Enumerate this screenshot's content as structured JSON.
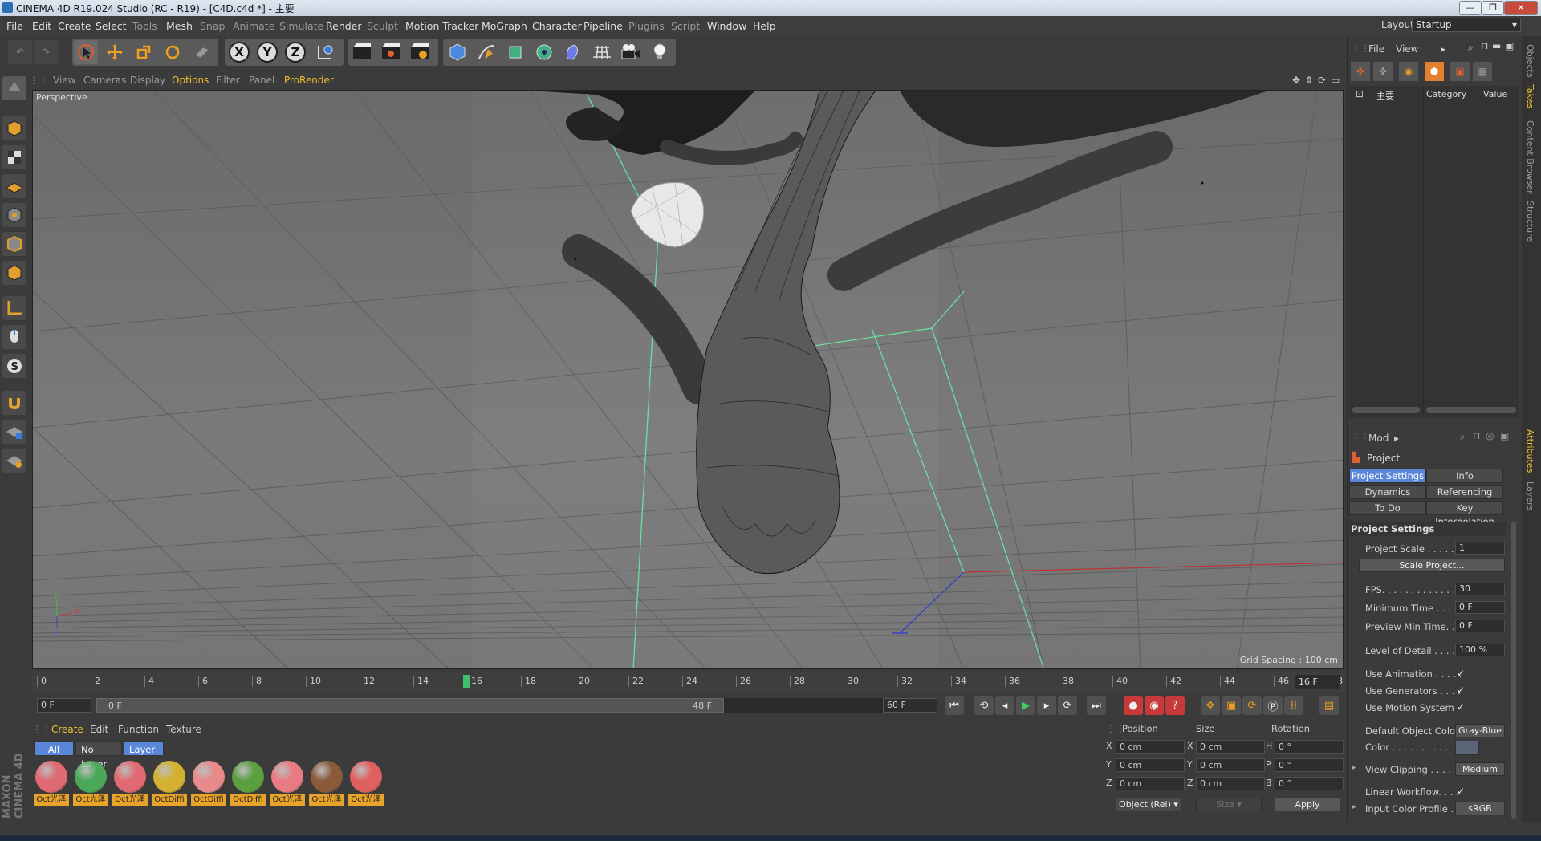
{
  "window": {
    "title": "CINEMA 4D R19.024 Studio (RC - R19) - [C4D.c4d *] - 主要",
    "buttons": [
      "—",
      "❐",
      "✕"
    ]
  },
  "menubar": {
    "items": [
      "File",
      "Edit",
      "Create",
      "Select",
      "Tools",
      "Mesh",
      "Snap",
      "Animate",
      "Simulate",
      "Render",
      "Sculpt",
      "Motion Tracker",
      "MoGraph",
      "Character",
      "Pipeline",
      "Plugins",
      "Script",
      "Window",
      "Help"
    ],
    "layout_label": "Layout:",
    "layout_value": "Startup"
  },
  "toolbar": {
    "axis_x": "X",
    "axis_y": "Y",
    "axis_z": "Z"
  },
  "viewport": {
    "menu": [
      "View",
      "Cameras",
      "Display",
      "Options",
      "Filter",
      "Panel",
      "ProRender"
    ],
    "active_menu": "Options",
    "label": "Perspective",
    "grid_spacing": "Grid Spacing : 100 cm"
  },
  "timeline": {
    "ticks": [
      "0",
      "2",
      "4",
      "6",
      "8",
      "10",
      "12",
      "14",
      "16",
      "18",
      "20",
      "22",
      "24",
      "26",
      "28",
      "30",
      "32",
      "34",
      "36",
      "38",
      "40",
      "42",
      "44",
      "46",
      "48"
    ],
    "current_frame": 16,
    "current_frame_label": "16 F",
    "start_field": "0 F",
    "range_start": "0 F",
    "range_end": "48 F",
    "end_field": "60 F"
  },
  "materials": {
    "menu": [
      "Create",
      "Edit",
      "Function",
      "Texture"
    ],
    "filters": [
      "All",
      "No Layer",
      "Layer"
    ],
    "selected_filter": "All",
    "items": [
      {
        "label": "Oct光泽",
        "color": "#e06a72"
      },
      {
        "label": "Oct光泽",
        "color": "#4aa85a"
      },
      {
        "label": "Oct光泽",
        "color": "#e06a72"
      },
      {
        "label": "OctDiffi",
        "color": "#d4b030"
      },
      {
        "label": "OctDiffi",
        "color": "#e88a8a"
      },
      {
        "label": "OctDiffi",
        "color": "#5aa040"
      },
      {
        "label": "Oct光泽",
        "color": "#e87a82"
      },
      {
        "label": "Oct光泽",
        "color": "#8a5a3a"
      },
      {
        "label": "Oct光泽",
        "color": "#e06060"
      }
    ]
  },
  "coordinates": {
    "headers": [
      "Position",
      "Size",
      "Rotation"
    ],
    "rows": [
      {
        "axis": "X",
        "pos": "0 cm",
        "saxis": "X",
        "size": "0 cm",
        "raxis": "H",
        "rot": "0 °"
      },
      {
        "axis": "Y",
        "pos": "0 cm",
        "saxis": "Y",
        "size": "0 cm",
        "raxis": "P",
        "rot": "0 °"
      },
      {
        "axis": "Z",
        "pos": "0 cm",
        "saxis": "Z",
        "size": "0 cm",
        "raxis": "B",
        "rot": "0 °"
      }
    ],
    "mode": "Object (Rel)",
    "size_mode": "Size",
    "apply": "Apply"
  },
  "objects_panel": {
    "menu": [
      "File",
      "View"
    ],
    "take_name": "主要",
    "col_category": "Category",
    "col_value": "Value"
  },
  "attributes": {
    "mode": "Mod",
    "object": "Project",
    "tabs": [
      {
        "label": "Project Settings",
        "selected": true
      },
      {
        "label": "Info",
        "selected": false
      },
      {
        "label": "Dynamics",
        "selected": false
      },
      {
        "label": "Referencing",
        "selected": false
      },
      {
        "label": "To Do",
        "selected": false
      },
      {
        "label": "Key Interpolation",
        "selected": false
      }
    ],
    "section": "Project Settings",
    "project_scale_label": "Project Scale . . . . . .",
    "project_scale": "1",
    "scale_button": "Scale Project...",
    "fps_label": "FPS. . . . . . . . . . . . . .",
    "fps": "30",
    "min_time_label": "Minimum Time . . . . .",
    "min_time": "0 F",
    "preview_min_label": "Preview Min Time. . .",
    "preview_min": "0 F",
    "lod_label": "Level of Detail . . . . .",
    "lod": "100 %",
    "use_anim_label": "Use Animation . . . . .",
    "use_gen_label": "Use Generators . . . .",
    "use_motion_label": "Use Motion System",
    "check": "✓",
    "def_color_label": "Default Object Color",
    "def_color": "Gray-Blue",
    "color_label": "Color . . . . . . . . . .",
    "view_clip_label": "View Clipping . . . . .",
    "view_clip": "Medium",
    "linear_label": "Linear Workflow. . . .",
    "input_profile_label": "Input Color Profile . .",
    "input_profile": "sRGB"
  },
  "sidetabs": [
    "Objects",
    "Takes",
    "Content Browser",
    "Structure",
    "Attributes",
    "Layers"
  ],
  "brand": "MAXON CINEMA 4D"
}
